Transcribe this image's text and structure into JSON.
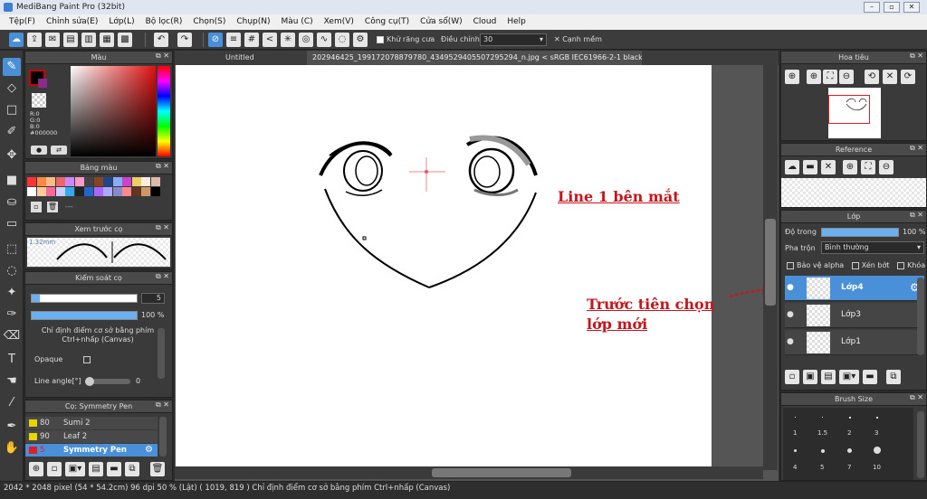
{
  "window": {
    "title": "MediBang Paint Pro (32bit)"
  },
  "menu": [
    "Tệp(F)",
    "Chỉnh sửa(E)",
    "Lớp(L)",
    "Bộ lọc(R)",
    "Chọn(S)",
    "Chụp(N)",
    "Màu (C)",
    "Xem(V)",
    "Công cụ(T)",
    "Cửa sổ(W)",
    "Cloud",
    "Help"
  ],
  "toolbar": {
    "antialias_label": "Khử răng cưa",
    "adjust_label": "Điều chỉnh",
    "adjust_value": "30",
    "soft_edge_label": "Cạnh mềm"
  },
  "panels": {
    "color": {
      "title": "Màu",
      "r": "R:0",
      "g": "G:0",
      "b": "B:0",
      "hex": "#000000"
    },
    "palette": {
      "title": "Bảng màu",
      "extra": "---"
    },
    "preview": {
      "title": "Xem trước cọ",
      "size": "1.32mm"
    },
    "brush_control": {
      "title": "Kiểm soát cọ",
      "size_value": "5",
      "opacity_value": "100 %",
      "hint": "Chỉ định điểm cơ sở bằng phím Ctrl+nhấp (Canvas)",
      "opaque_label": "Opaque",
      "line_angle_label": "Line angle[°]",
      "line_angle_value": "0"
    },
    "brush": {
      "title": "Cọ: Symmetry Pen",
      "items": [
        {
          "size": "80",
          "name": "Sumi 2",
          "color": "#e8d400"
        },
        {
          "size": "90",
          "name": "Leaf 2",
          "color": "#e8d400"
        },
        {
          "size": "5",
          "name": "Symmetry Pen",
          "color": "#e02020"
        }
      ]
    },
    "navigator": {
      "title": "Hoa tiêu"
    },
    "reference": {
      "title": "Reference"
    },
    "layer": {
      "title": "Lớp",
      "opacity_label": "Độ trong",
      "opacity_value": "100 %",
      "opacity_fraction": 1.0,
      "blend_label": "Pha trộn",
      "blend_value": "Bình thường",
      "protect_alpha": "Bảo vệ alpha",
      "clipping": "Xén bớt",
      "lock": "Khóa",
      "layers": [
        "Lớp4",
        "Lớp3",
        "Lớp1"
      ]
    },
    "brush_size": {
      "title": "Brush Size",
      "sizes": [
        "1",
        "1.5",
        "2",
        "3",
        "4",
        "5",
        "7",
        "10"
      ]
    }
  },
  "canvas": {
    "tab_active": "Untitled",
    "tab_file": "202946425_199172078879780_4349529405507295294_n.jpg < sRGB IEC61966-2-1 black scaled >",
    "annotation1": "Line 1 bên mắt",
    "annotation2_line1": "Trước tiên chọn",
    "annotation2_line2": "lớp mới"
  },
  "status": {
    "text": "2042 * 2048 pixel   (54 * 54.2cm)   96 dpi   50 % (Lật)   ( 1019, 819 )   Chỉ định điểm cơ sở bằng phím Ctrl+nhấp (Canvas)"
  },
  "colors": {
    "accent": "#4a90d9",
    "panel": "#3a3a3a",
    "annotation": "#c4161c"
  }
}
